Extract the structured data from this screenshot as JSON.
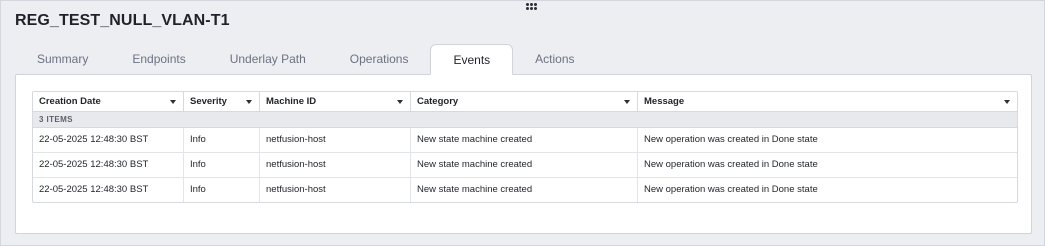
{
  "window": {
    "title": "REG_TEST_NULL_VLAN-T1"
  },
  "tabs": [
    {
      "label": "Summary"
    },
    {
      "label": "Endpoints"
    },
    {
      "label": "Underlay Path"
    },
    {
      "label": "Operations"
    },
    {
      "label": "Events",
      "active": true
    },
    {
      "label": "Actions"
    }
  ],
  "table": {
    "columns": [
      "Creation Date",
      "Severity",
      "Machine ID",
      "Category",
      "Message"
    ],
    "count_label": "3 ITEMS",
    "rows": [
      [
        "22-05-2025 12:48:30 BST",
        "Info",
        "netfusion-host",
        "New state machine created",
        "New operation was created in Done state"
      ],
      [
        "22-05-2025 12:48:30 BST",
        "Info",
        "netfusion-host",
        "New state machine created",
        "New operation was created in Done state"
      ],
      [
        "22-05-2025 12:48:30 BST",
        "Info",
        "netfusion-host",
        "New state machine created",
        "New operation was created in Done state"
      ]
    ]
  }
}
